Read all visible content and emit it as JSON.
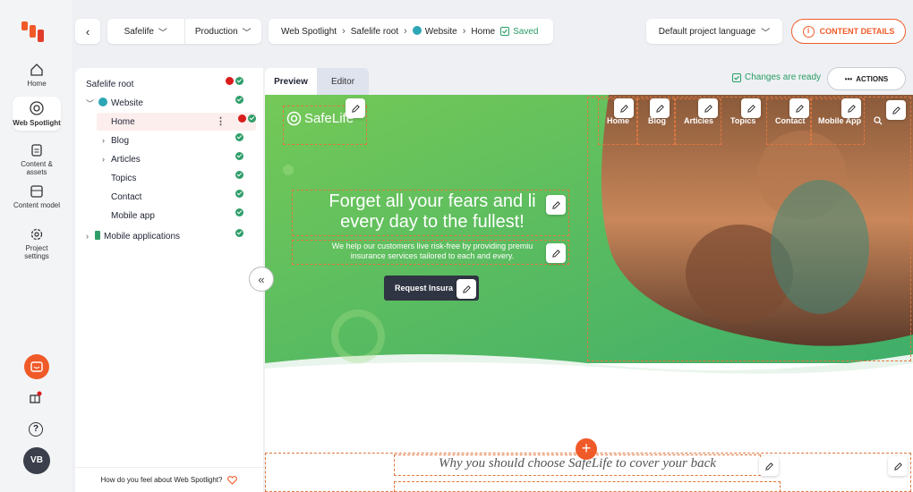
{
  "nav": {
    "items": [
      {
        "label": "Home"
      },
      {
        "label": "Web Spotlight"
      },
      {
        "label": "Content & assets"
      },
      {
        "label": "Content model"
      },
      {
        "label": "Project settings"
      }
    ],
    "avatar": "VB",
    "help": "?"
  },
  "topbar": {
    "back": "‹",
    "project": "Safelife",
    "environment": "Production",
    "breadcrumb": [
      "Web Spotlight",
      "Safelife root",
      "Website",
      "Home"
    ],
    "saved_label": "Saved",
    "language": "Default project language",
    "content_details": "CONTENT DETAILS"
  },
  "tree": {
    "root": "Safelife root",
    "website": "Website",
    "home": "Home",
    "blog": "Blog",
    "articles": "Articles",
    "topics": "Topics",
    "contact": "Contact",
    "mobile_app": "Mobile app",
    "mobile_applications": "Mobile applications",
    "feedback": "How do you feel about Web Spotlight?"
  },
  "tabs": {
    "preview": "Preview",
    "editor": "Editor"
  },
  "status": {
    "changes": "Changes are ready",
    "actions": "ACTIONS"
  },
  "site": {
    "logo": "SafeLife",
    "nav": [
      "Home",
      "Blog",
      "Articles",
      "Topics",
      "Contact",
      "Mobile App"
    ],
    "hero_title_1": "Forget all your fears and li",
    "hero_title_2": "every day to the fullest!",
    "hero_sub_1": "We help our customers live risk-free by providing premiu",
    "hero_sub_2": "insurance services tailored to each and every.",
    "hero_button": "Request Insura",
    "section_title": "Why you should choose SafeLife to cover your back"
  },
  "colors": {
    "accent": "#f05a28",
    "success": "#2f9e6a",
    "hero_green": "#5fbf5a"
  }
}
